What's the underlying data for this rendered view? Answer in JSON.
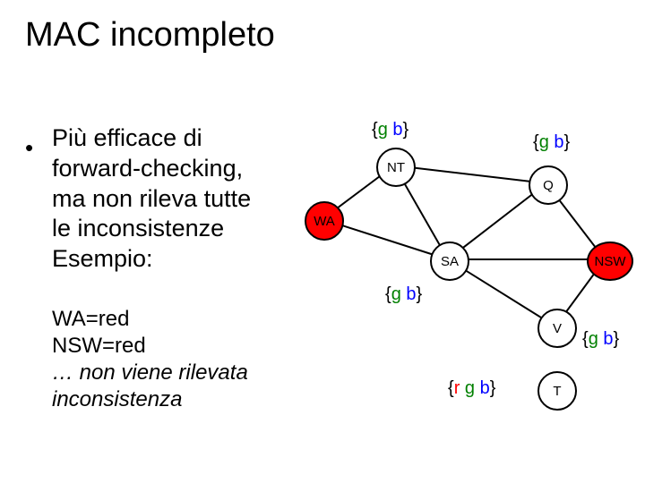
{
  "title": "MAC incompleto",
  "bullet_char": "•",
  "body": "Più efficace di forward-checking, ma non rileva tutte le inconsistenze Esempio:",
  "sub1": "WA=red",
  "sub2": "NSW=red",
  "sub3": "… non viene rilevata inconsistenza",
  "graph": {
    "nodes": {
      "WA": "WA",
      "NT": "NT",
      "Q": "Q",
      "SA": "SA",
      "NSW": "NSW",
      "V": "V",
      "T": "T"
    },
    "labels": {
      "nt_dom": {
        "g": "g",
        "b": "b"
      },
      "q_dom": {
        "g": "g",
        "b": "b"
      },
      "sa_dom": {
        "g": "g",
        "b": "b"
      },
      "v_dom": {
        "g": "g",
        "b": "b"
      },
      "t_dom": {
        "r": "r",
        "g": "g",
        "b": "b"
      }
    },
    "brace_open": "{",
    "brace_close": "}"
  }
}
